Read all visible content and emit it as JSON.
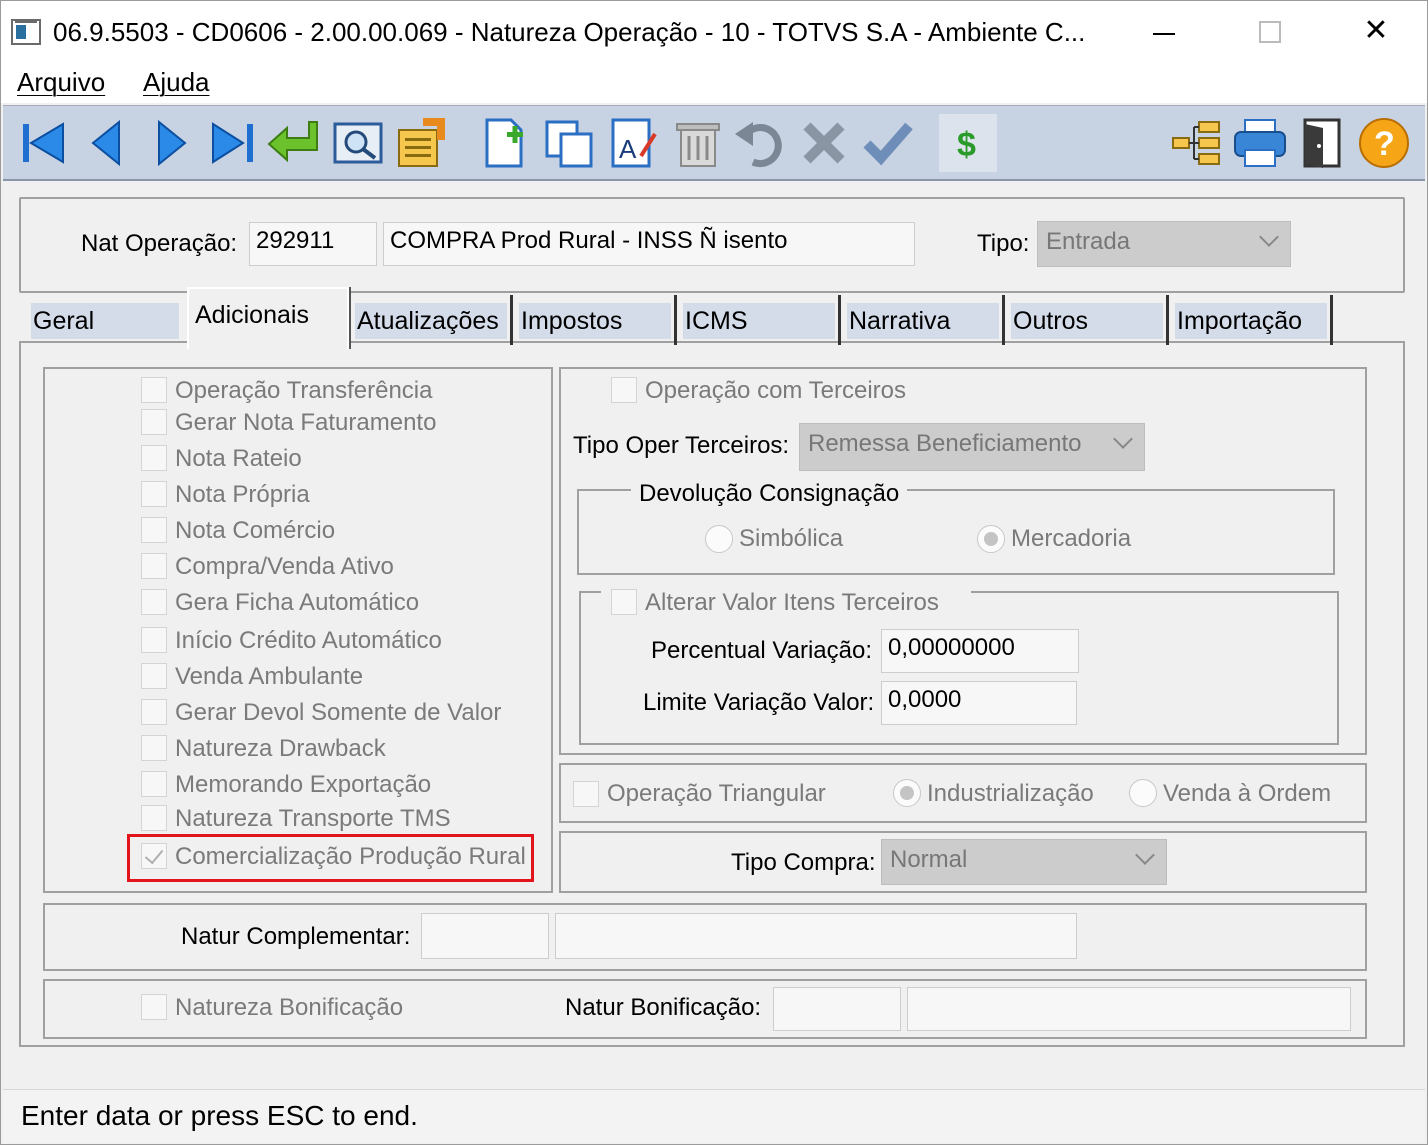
{
  "window": {
    "title": "06.9.5503 - CD0606 - 2.00.00.069 - Natureza Operação - 10 - TOTVS S.A - Ambiente C...",
    "minimize_glyph": "—",
    "close_glyph": "✕"
  },
  "menu": {
    "items": [
      "Arquivo",
      "Ajuda"
    ]
  },
  "toolbar": {
    "icons": [
      "first-icon",
      "previous-icon",
      "next-icon",
      "last-icon",
      "goto-icon",
      "search-icon",
      "list-icon",
      "add-icon",
      "copy-icon",
      "edit-icon",
      "delete-icon",
      "undo-icon",
      "cancel-icon",
      "save-icon",
      "currency-icon",
      "tree-icon",
      "print-icon",
      "exit-icon",
      "help-icon"
    ],
    "currency_symbol": "$",
    "help_symbol": "?"
  },
  "header": {
    "nat_label": "Nat Operação:",
    "nat_code": "292911",
    "nat_desc": "COMPRA Prod Rural - INSS Ñ isento",
    "tipo_label": "Tipo:",
    "tipo_value": "Entrada"
  },
  "tabs": [
    "Geral",
    "Adicionais",
    "Atualizações",
    "Impostos",
    "ICMS",
    "Narrativa",
    "Outros",
    "Importação"
  ],
  "active_tab": "Adicionais",
  "left_checkboxes": [
    {
      "label": "Operação Transferência",
      "checked": false
    },
    {
      "label": "Gerar Nota Faturamento",
      "checked": false
    },
    {
      "label": "Nota Rateio",
      "checked": false
    },
    {
      "label": "Nota Própria",
      "checked": false
    },
    {
      "label": "Nota Comércio",
      "checked": false
    },
    {
      "label": "Compra/Venda Ativo",
      "checked": false
    },
    {
      "label": "Gera Ficha Automático",
      "checked": false
    },
    {
      "label": "Início Crédito Automático",
      "checked": false
    },
    {
      "label": "Venda Ambulante",
      "checked": false
    },
    {
      "label": "Gerar Devol Somente de Valor",
      "checked": false
    },
    {
      "label": "Natureza Drawback",
      "checked": false
    },
    {
      "label": "Memorando Exportação",
      "checked": false
    },
    {
      "label": "Natureza Transporte TMS",
      "checked": false
    },
    {
      "label": "Comercialização Produção Rural",
      "checked": true
    }
  ],
  "terceiros": {
    "op_label": "Operação com Terceiros",
    "tipo_label": "Tipo Oper Terceiros:",
    "tipo_value": "Remessa Beneficiamento",
    "devolucao_legend": "Devolução Consignação",
    "radio_simbolica": "Simbólica",
    "radio_mercadoria": "Mercadoria",
    "alterar_label": "Alterar Valor Itens Terceiros",
    "percentual_label": "Percentual Variação:",
    "percentual_value": "0,00000000",
    "limite_label": "Limite Variação Valor:",
    "limite_value": "0,0000"
  },
  "triangular": {
    "label": "Operação Triangular",
    "radio_industrializacao": "Industrialização",
    "radio_venda_ordem": "Venda à Ordem"
  },
  "tipo_compra": {
    "label": "Tipo Compra:",
    "value": "Normal"
  },
  "complementar": {
    "label": "Natur Complementar:",
    "code": "",
    "desc": ""
  },
  "bonificacao": {
    "checkbox_label": "Natureza Bonificação",
    "label": "Natur Bonificação:",
    "code": "",
    "desc": ""
  },
  "status": {
    "text": "Enter data or press ESC to end."
  },
  "colors": {
    "highlight": "#e3151c",
    "toolbar_bg": "#c7d2e2",
    "tab_label_bg": "#d4dce9"
  }
}
